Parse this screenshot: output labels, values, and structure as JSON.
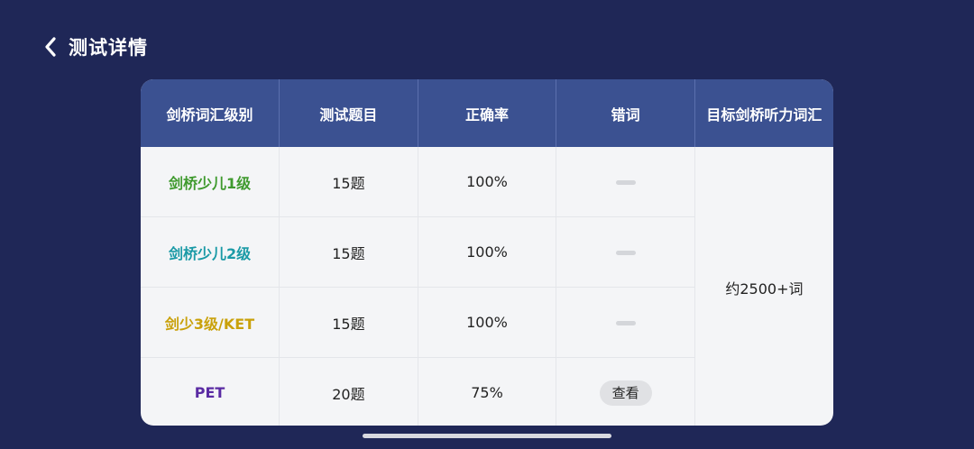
{
  "header": {
    "title": "测试详情"
  },
  "table": {
    "columns": [
      "剑桥词汇级别",
      "测试题目",
      "正确率",
      "错词",
      "目标剑桥听力词汇"
    ],
    "rows": [
      {
        "level": "剑桥少儿1级",
        "level_color": "#3f9a2e",
        "questions": "15题",
        "accuracy": "100%",
        "wrong_words": "dash"
      },
      {
        "level": "剑桥少儿2级",
        "level_color": "#1a9aa6",
        "questions": "15题",
        "accuracy": "100%",
        "wrong_words": "dash"
      },
      {
        "level": "剑少3级/KET",
        "level_color": "#c9a10a",
        "questions": "15题",
        "accuracy": "100%",
        "wrong_words": "dash"
      },
      {
        "level": "PET",
        "level_color": "#5a2ba3",
        "questions": "20题",
        "accuracy": "75%",
        "wrong_words": "查看"
      }
    ],
    "target_vocab": "约2500+词"
  },
  "colors": {
    "background": "#1f2757",
    "header_row": "#3b5191",
    "table_body": "#f4f5f7"
  }
}
